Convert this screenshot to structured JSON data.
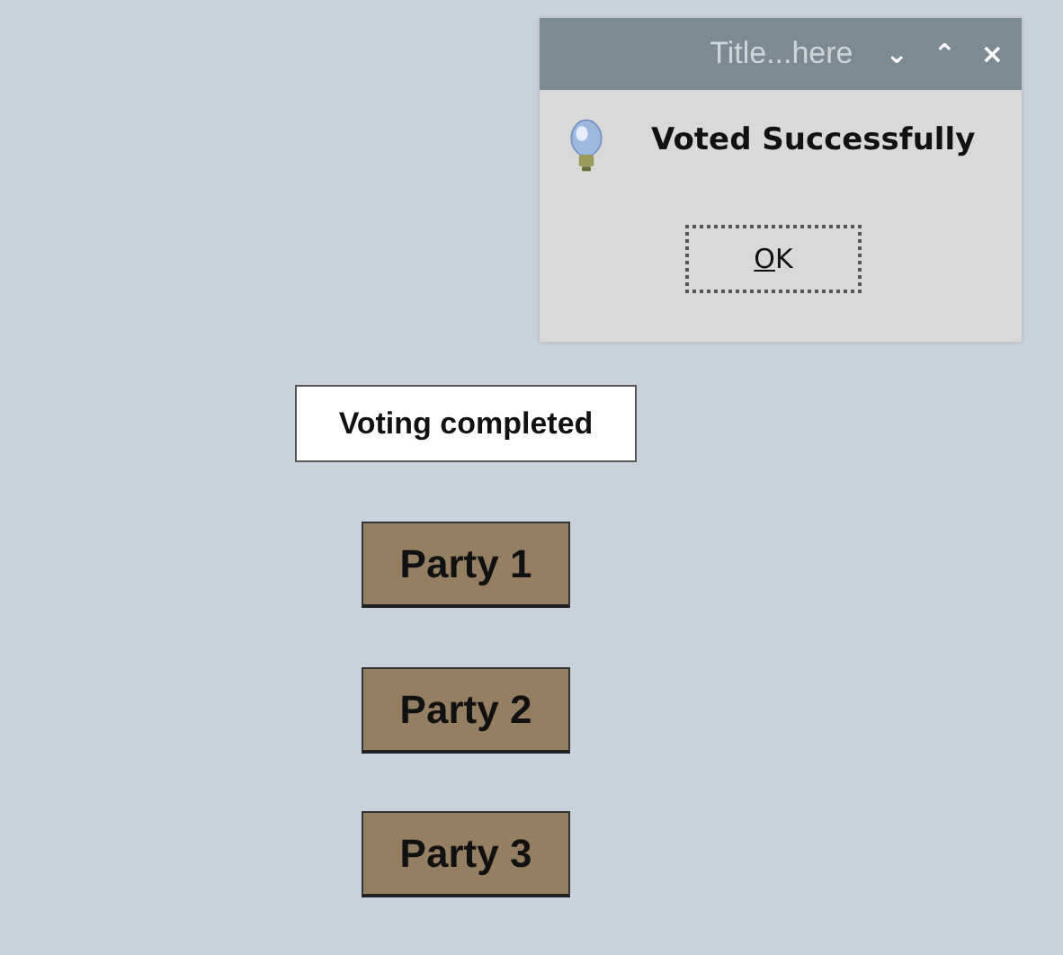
{
  "dialog": {
    "title": "Title...here",
    "title_buttons": [
      "⌄",
      "⌃",
      "×"
    ],
    "message": "Voted Successfully",
    "button": {
      "label": "OK",
      "first_letter_underlined": true
    }
  },
  "status_label": "Voting completed",
  "parties": [
    {
      "label": "Party 1"
    },
    {
      "label": "Party 2"
    },
    {
      "label": "Party 3"
    }
  ]
}
